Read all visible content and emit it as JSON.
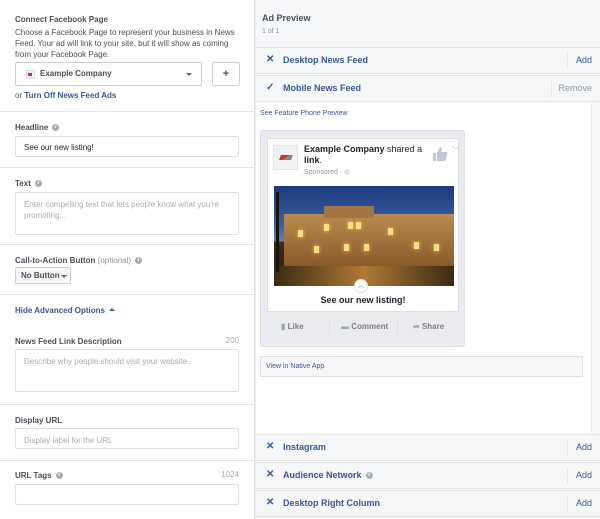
{
  "left": {
    "connect_page": {
      "title": "Connect Facebook Page",
      "description": "Choose a Facebook Page to represent your business in News Feed. Your ad will link to your site, but it will show as coming from your Facebook Page.",
      "selected_page": "Example Company",
      "add_button": "+",
      "or_text": "or",
      "turn_off_link": "Turn Off News Feed Ads"
    },
    "headline": {
      "label": "Headline",
      "value": "See our new listing!"
    },
    "text": {
      "label": "Text",
      "placeholder": "Enter compelling text that lets people know what you're promoting..."
    },
    "cta": {
      "label": "Call-to-Action Button",
      "optional": "(optional)",
      "selected": "No Button"
    },
    "advanced_toggle": "Hide Advanced Options",
    "link_description": {
      "label": "News Feed Link Description",
      "count": "200",
      "placeholder": "Describe why people should visit your website."
    },
    "display_url": {
      "label": "Display URL",
      "placeholder": "Display label for the URL"
    },
    "url_tags": {
      "label": "URL Tags",
      "count": "1024",
      "value": ""
    }
  },
  "right": {
    "title": "Ad Preview",
    "subtitle": "1 of 1",
    "placements_top": [
      {
        "icon": "✕",
        "name": "Desktop News Feed",
        "action": "Add",
        "selected": false
      },
      {
        "icon": "✓",
        "name": "Mobile News Feed",
        "action": "Remove",
        "selected": true
      }
    ],
    "feature_phone_link": "See Feature Phone Preview",
    "post": {
      "page_name": "Example Company",
      "shared_text": "shared a",
      "link_word": "link",
      "sponsored": "Sponsored · ",
      "headline": "See our new listing!",
      "actions": [
        "Like",
        "Comment",
        "Share"
      ]
    },
    "native_app_link": "View in Native App",
    "placements_bottom": [
      {
        "icon": "✕",
        "name": "Instagram",
        "action": "Add",
        "info": false
      },
      {
        "icon": "✕",
        "name": "Audience Network",
        "action": "Add",
        "info": true
      },
      {
        "icon": "✕",
        "name": "Desktop Right Column",
        "action": "Add",
        "info": false
      }
    ]
  }
}
